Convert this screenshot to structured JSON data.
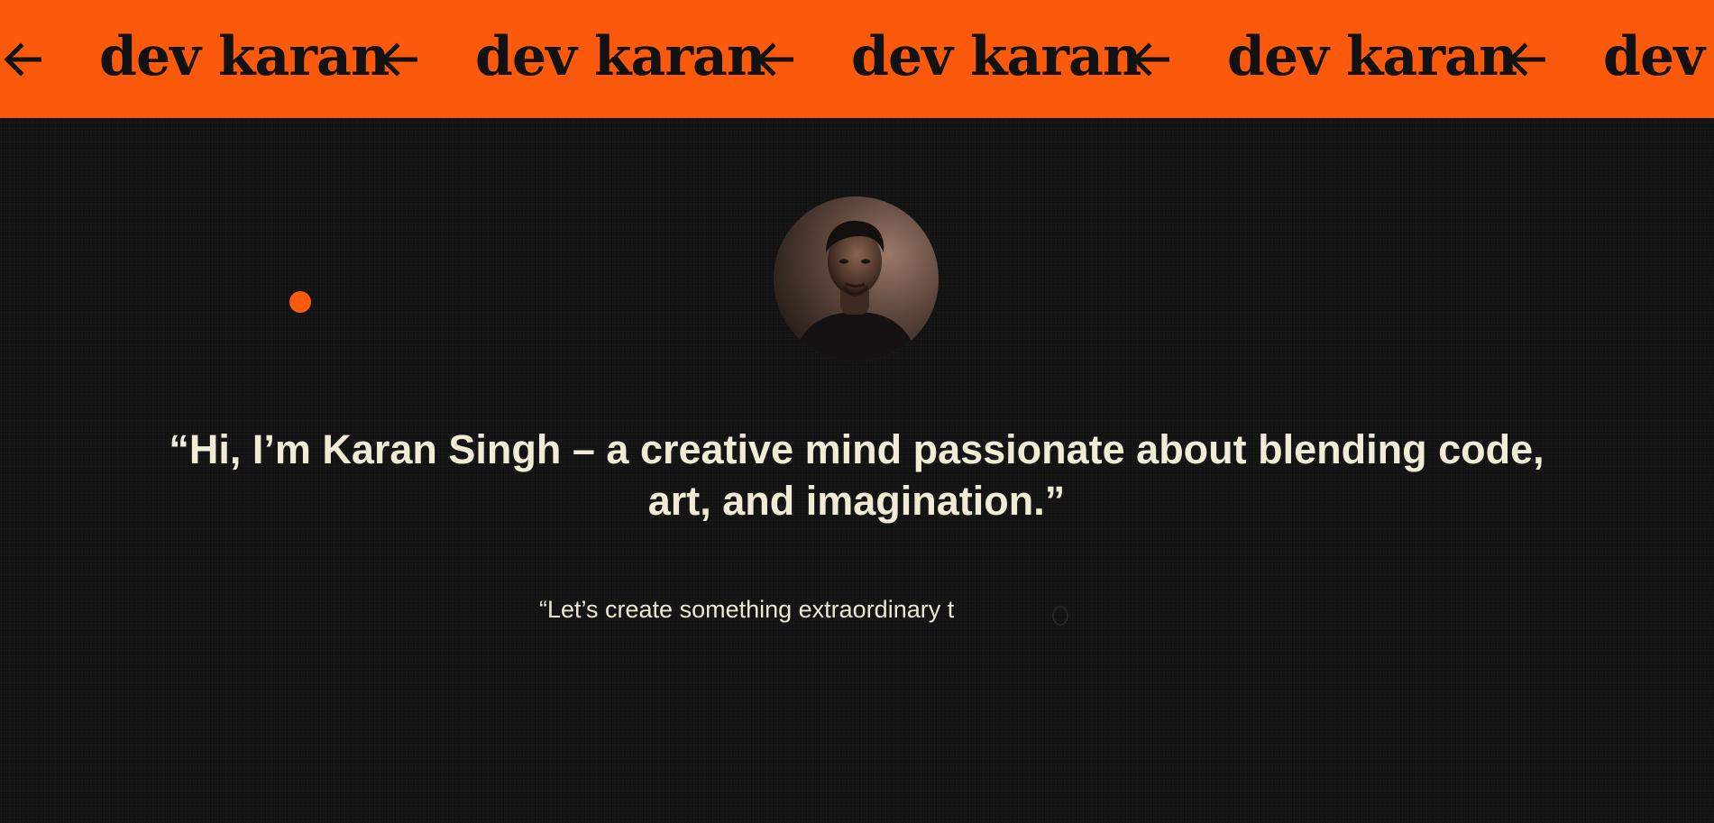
{
  "marquee": {
    "brand": "dev karan",
    "arrow_icon": "arrow-left-icon",
    "background": "#fb5a0c",
    "text_color": "#121212"
  },
  "hero": {
    "avatar_alt": "Karan Singh portrait",
    "headline_line1": "“Hi, I’m Karan Singh – a creative mind passionate about blending code,",
    "headline_line2": "art, and imagination.”",
    "subline": "“Let’s create something extraordinary t",
    "accent_color": "#fb5a0c",
    "text_color": "#f0ecd6",
    "background": "#131313"
  }
}
